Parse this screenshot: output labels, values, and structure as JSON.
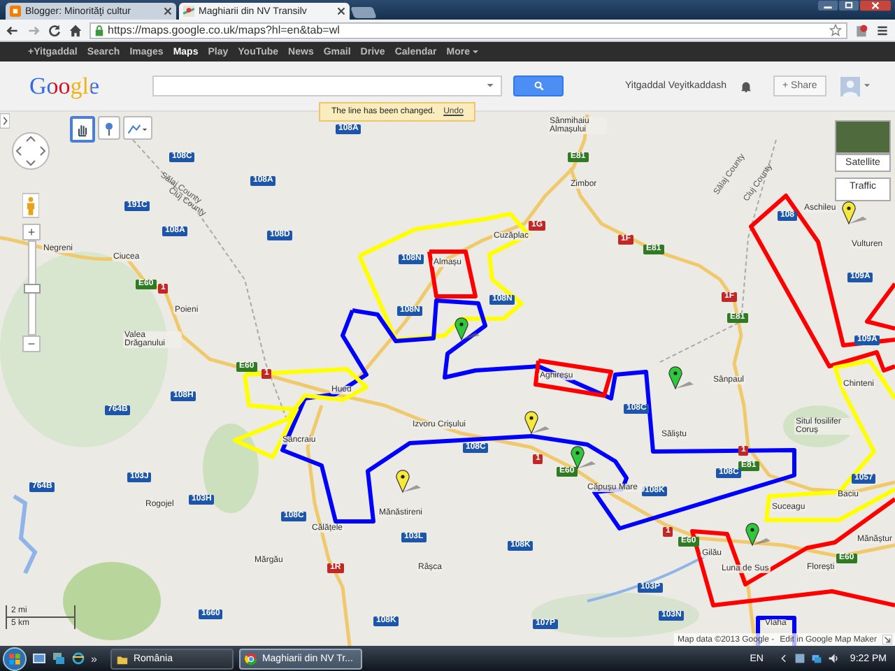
{
  "browser": {
    "tabs": [
      {
        "title": "Blogger: Minorităţi cultur",
        "selected": false
      },
      {
        "title": "Maghiarii din NV Transilv",
        "selected": true
      }
    ],
    "url": "https://maps.google.co.uk/maps?hl=en&tab=wl"
  },
  "google_bar": {
    "items": [
      {
        "label": "+Yitgaddal",
        "selected": false
      },
      {
        "label": "Search",
        "selected": false
      },
      {
        "label": "Images",
        "selected": false
      },
      {
        "label": "Maps",
        "selected": true
      },
      {
        "label": "Play",
        "selected": false
      },
      {
        "label": "YouTube",
        "selected": false
      },
      {
        "label": "News",
        "selected": false
      },
      {
        "label": "Gmail",
        "selected": false
      },
      {
        "label": "Drive",
        "selected": false
      },
      {
        "label": "Calendar",
        "selected": false
      },
      {
        "label": "More",
        "selected": false
      }
    ]
  },
  "header": {
    "logo": "Google",
    "user_name": "Yitgaddal Veyitkaddash",
    "share_label": "+ Share"
  },
  "toast": {
    "message": "The line has been changed.",
    "action": "Undo"
  },
  "map": {
    "tools": [
      {
        "kind": "hand",
        "selected": true
      },
      {
        "kind": "marker",
        "selected": false
      },
      {
        "kind": "line",
        "selected": false
      }
    ],
    "zoom": {
      "plus": "+",
      "minus": "−",
      "level": 0.5
    },
    "layers": [
      "Satellite",
      "Traffic"
    ],
    "county_labels": [
      "Sălaj County",
      "Cluj County",
      "Sălaj County",
      "Cluj County"
    ],
    "places": [
      "Sânmihaiu Almașului",
      "Negreni",
      "Ciucea",
      "Poieni",
      "Valea Drăganului",
      "Hued",
      "Almașu",
      "Cuzăplac",
      "Zimbor",
      "Aghireșu",
      "Aschileu",
      "Vulturen",
      "Chinteni",
      "Sânpaul",
      "Izvoru Crișului",
      "Sâncraiu",
      "Călățele",
      "Mănăstireni",
      "Rogojel",
      "Mărgău",
      "Râșca",
      "Săliștu",
      "Situl fosilifer Coruș",
      "Baciu",
      "Suceagu",
      "Gilău",
      "Luna de Sus",
      "Florești",
      "Căpușu Mare",
      "Mănăștur",
      "Vlaha"
    ],
    "roads": [
      {
        "number": "108A",
        "kind": "county"
      },
      {
        "number": "108C",
        "kind": "county"
      },
      {
        "number": "108A",
        "kind": "county"
      },
      {
        "number": "191C",
        "kind": "county"
      },
      {
        "number": "108A",
        "kind": "county"
      },
      {
        "number": "108D",
        "kind": "county"
      },
      {
        "number": "108N",
        "kind": "county"
      },
      {
        "number": "108N",
        "kind": "county"
      },
      {
        "number": "108N",
        "kind": "county"
      },
      {
        "number": "E60",
        "kind": "european"
      },
      {
        "number": "1",
        "kind": "national"
      },
      {
        "number": "E60",
        "kind": "european"
      },
      {
        "number": "1",
        "kind": "national"
      },
      {
        "number": "108H",
        "kind": "county"
      },
      {
        "number": "E81",
        "kind": "european"
      },
      {
        "number": "1G",
        "kind": "national"
      },
      {
        "number": "1F",
        "kind": "national"
      },
      {
        "number": "E81",
        "kind": "european"
      },
      {
        "number": "1F",
        "kind": "national"
      },
      {
        "number": "E81",
        "kind": "european"
      },
      {
        "number": "108",
        "kind": "county"
      },
      {
        "number": "109A",
        "kind": "county"
      },
      {
        "number": "109A",
        "kind": "county"
      },
      {
        "number": "764B",
        "kind": "county"
      },
      {
        "number": "764B",
        "kind": "county"
      },
      {
        "number": "103J",
        "kind": "county"
      },
      {
        "number": "103H",
        "kind": "county"
      },
      {
        "number": "108C",
        "kind": "county"
      },
      {
        "number": "1R",
        "kind": "national"
      },
      {
        "number": "103L",
        "kind": "county"
      },
      {
        "number": "1660",
        "kind": "county"
      },
      {
        "number": "108K",
        "kind": "county"
      },
      {
        "number": "108C",
        "kind": "county"
      },
      {
        "number": "1",
        "kind": "national"
      },
      {
        "number": "E60",
        "kind": "european"
      },
      {
        "number": "108C",
        "kind": "county"
      },
      {
        "number": "1",
        "kind": "national"
      },
      {
        "number": "E81",
        "kind": "european"
      },
      {
        "number": "108C",
        "kind": "county"
      },
      {
        "number": "108K",
        "kind": "county"
      },
      {
        "number": "1",
        "kind": "national"
      },
      {
        "number": "E60",
        "kind": "european"
      },
      {
        "number": "108K",
        "kind": "county"
      },
      {
        "number": "1057",
        "kind": "county"
      },
      {
        "number": "E60",
        "kind": "european"
      },
      {
        "number": "103P",
        "kind": "county"
      },
      {
        "number": "103N",
        "kind": "county"
      },
      {
        "number": "107P",
        "kind": "county"
      }
    ],
    "shapes": [
      {
        "color": "#ffff00"
      },
      {
        "color": "#ff0000"
      },
      {
        "color": "#0000ff"
      },
      {
        "color": "#ff0000"
      },
      {
        "color": "#ffff00"
      },
      {
        "color": "#ff0000"
      },
      {
        "color": "#ffff00"
      },
      {
        "color": "#ff0000"
      },
      {
        "color": "#0000ff"
      },
      {
        "color": "#ff0000"
      }
    ],
    "pins": [
      {
        "color": "#f7e93c"
      },
      {
        "color": "#f7e93c"
      },
      {
        "color": "#f7e93c"
      },
      {
        "color": "#2ec83a"
      },
      {
        "color": "#2ec83a"
      },
      {
        "color": "#2ec83a"
      },
      {
        "color": "#2ec83a"
      }
    ],
    "scale": {
      "miles": "2 mi",
      "km": "5 km"
    },
    "attribution": "Map data ©2013 Google -",
    "edit_link": "Edit in Google Map Maker"
  },
  "taskbar": {
    "more": "»",
    "tasks": [
      {
        "label": "România",
        "selected": false
      },
      {
        "label": "Maghiarii din NV Tr...",
        "selected": true
      }
    ],
    "language": "EN",
    "clock": "9:22 PM"
  }
}
